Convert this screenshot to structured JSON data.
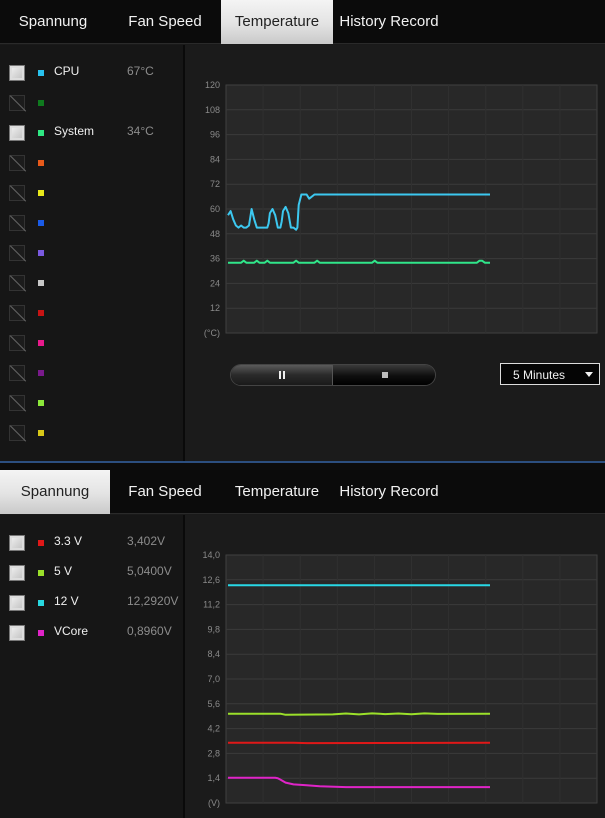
{
  "tabs": [
    {
      "label": "Spannung"
    },
    {
      "label": "Fan Speed"
    },
    {
      "label": "Temperature"
    },
    {
      "label": "History Record"
    }
  ],
  "temperature_panel": {
    "active_tab": "Temperature",
    "sensors": [
      {
        "name": "CPU",
        "value": "67°C",
        "checked": true,
        "color": "#29c2ee"
      },
      {
        "name": "",
        "value": "",
        "checked": false,
        "color": "#0f7a1e"
      },
      {
        "name": "System",
        "value": "34°C",
        "checked": true,
        "color": "#2fe883"
      },
      {
        "name": "",
        "value": "",
        "checked": false,
        "color": "#e85a1a"
      },
      {
        "name": "",
        "value": "",
        "checked": false,
        "color": "#e8e81a"
      },
      {
        "name": "",
        "value": "",
        "checked": false,
        "color": "#1a5be8"
      },
      {
        "name": "",
        "value": "",
        "checked": false,
        "color": "#7a5ae0"
      },
      {
        "name": "",
        "value": "",
        "checked": false,
        "color": "#c8c8c8"
      },
      {
        "name": "",
        "value": "",
        "checked": false,
        "color": "#c81414"
      },
      {
        "name": "",
        "value": "",
        "checked": false,
        "color": "#e81a8c"
      },
      {
        "name": "",
        "value": "",
        "checked": false,
        "color": "#7a1a8c"
      },
      {
        "name": "",
        "value": "",
        "checked": false,
        "color": "#8ce83a"
      },
      {
        "name": "",
        "value": "",
        "checked": false,
        "color": "#d8c818"
      }
    ],
    "controls": {
      "time_range": "5 Minutes"
    }
  },
  "voltage_panel": {
    "active_tab": "Spannung",
    "sensors": [
      {
        "name": "3.3 V",
        "value": "3,402V",
        "checked": true,
        "color": "#e01818"
      },
      {
        "name": "5 V",
        "value": "5,0400V",
        "checked": true,
        "color": "#9be02a"
      },
      {
        "name": "12 V",
        "value": "12,2920V",
        "checked": true,
        "color": "#28d8e0"
      },
      {
        "name": "VCore",
        "value": "0,8960V",
        "checked": true,
        "color": "#e024c8"
      }
    ]
  },
  "chart_data": [
    {
      "type": "line",
      "title": "",
      "ylabel": "(°C)",
      "ylim": [
        0,
        120
      ],
      "yticks": [
        "120",
        "108",
        "96",
        "84",
        "72",
        "60",
        "48",
        "36",
        "24",
        "12"
      ],
      "grid": true,
      "xlim": [
        0,
        100
      ],
      "series": [
        {
          "name": "CPU",
          "color": "#3cc8f0",
          "x": [
            0,
            1,
            2,
            3,
            4,
            5,
            6,
            7,
            8,
            8.5,
            9,
            10,
            11,
            12,
            13,
            14,
            15,
            15.5,
            16,
            17,
            18,
            19,
            20,
            20.5,
            21,
            22,
            23,
            24,
            25,
            26,
            26.5,
            27,
            28,
            29,
            30,
            31,
            33,
            36,
            40,
            50,
            60,
            70,
            80,
            90,
            100
          ],
          "y": [
            57,
            59,
            55,
            52,
            51,
            52,
            51,
            51,
            52,
            56,
            60,
            55,
            51,
            51,
            51,
            51,
            51,
            53,
            58,
            60,
            57,
            51,
            51,
            54,
            59,
            61,
            58,
            51,
            51,
            50,
            51,
            62,
            67,
            67,
            67,
            65,
            67,
            67,
            67,
            67,
            67,
            67,
            67,
            67,
            67
          ]
        },
        {
          "name": "System",
          "color": "#30e68a",
          "x": [
            0,
            5,
            6,
            7,
            10,
            11,
            12,
            14,
            15,
            16,
            20,
            25,
            26,
            27,
            33,
            34,
            35,
            50,
            55,
            56,
            57,
            70,
            80,
            95,
            96,
            97,
            98,
            100
          ],
          "y": [
            34,
            34,
            35,
            34,
            34,
            35,
            34,
            34,
            35,
            34,
            34,
            34,
            35,
            34,
            34,
            35,
            34,
            34,
            34,
            35,
            34,
            34,
            34,
            34,
            35,
            35,
            34,
            34
          ]
        }
      ]
    },
    {
      "type": "line",
      "title": "",
      "ylabel": "(V)",
      "ylim": [
        0,
        14
      ],
      "yticks": [
        "14,0",
        "12,6",
        "11,2",
        "9,8",
        "8,4",
        "7,0",
        "5,6",
        "4,2",
        "2,8",
        "1,4"
      ],
      "grid": true,
      "xlim": [
        0,
        100
      ],
      "series": [
        {
          "name": "12 V",
          "color": "#28d8e6",
          "x": [
            0,
            100
          ],
          "y": [
            12.29,
            12.29
          ]
        },
        {
          "name": "5 V",
          "color": "#9be02a",
          "x": [
            0,
            20,
            22,
            40,
            45,
            50,
            55,
            60,
            65,
            70,
            75,
            80,
            100
          ],
          "y": [
            5.04,
            5.04,
            4.98,
            5.0,
            5.05,
            5.0,
            5.06,
            5.02,
            5.05,
            5.01,
            5.06,
            5.03,
            5.04
          ]
        },
        {
          "name": "3.3 V",
          "color": "#e01818",
          "x": [
            0,
            25,
            30,
            100
          ],
          "y": [
            3.4,
            3.4,
            3.38,
            3.4
          ]
        },
        {
          "name": "VCore",
          "color": "#e024c8",
          "x": [
            0,
            18,
            19,
            20,
            22,
            25,
            30,
            35,
            45,
            60,
            100
          ],
          "y": [
            1.42,
            1.42,
            1.4,
            1.32,
            1.15,
            1.05,
            1.0,
            0.94,
            0.9,
            0.896,
            0.896
          ]
        }
      ]
    }
  ]
}
